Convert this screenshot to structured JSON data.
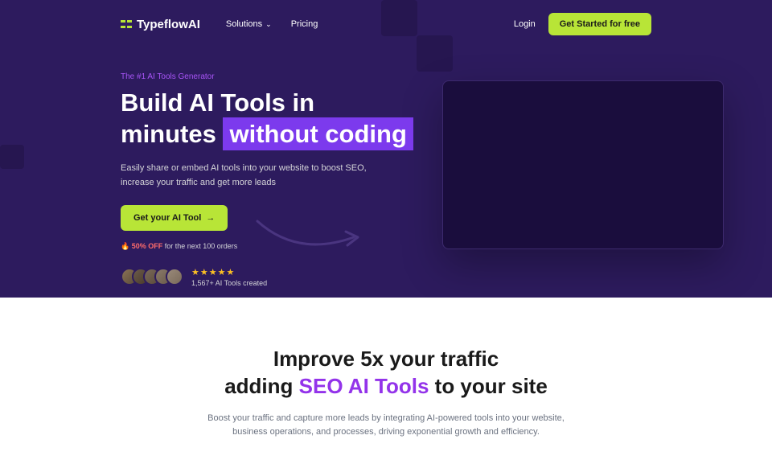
{
  "nav": {
    "brand": "TypeflowAI",
    "links": {
      "solutions": "Solutions",
      "pricing": "Pricing"
    },
    "login": "Login",
    "cta": "Get Started for free"
  },
  "hero": {
    "tagline": "The #1 AI Tools Generator",
    "title_line1": "Build AI Tools in",
    "title_line2_pre": "minutes",
    "title_highlight": "without coding",
    "subtitle": "Easily share or embed AI tools into your website to boost SEO, increase your traffic and get more leads",
    "cta": "Get your AI Tool",
    "offer_badge": "🔥 50% OFF",
    "offer_text": " for the next 100 orders",
    "stars": "★★★★★",
    "count": "1,567+ AI Tools created"
  },
  "section2": {
    "title_line1": "Improve 5x your traffic",
    "title_line2_pre": "adding ",
    "title_highlight": "SEO AI Tools",
    "title_line2_post": " to your site",
    "subtitle": "Boost your traffic and capture more leads by integrating AI-powered tools into your website, business operations, and processes, driving exponential growth and efficiency."
  }
}
